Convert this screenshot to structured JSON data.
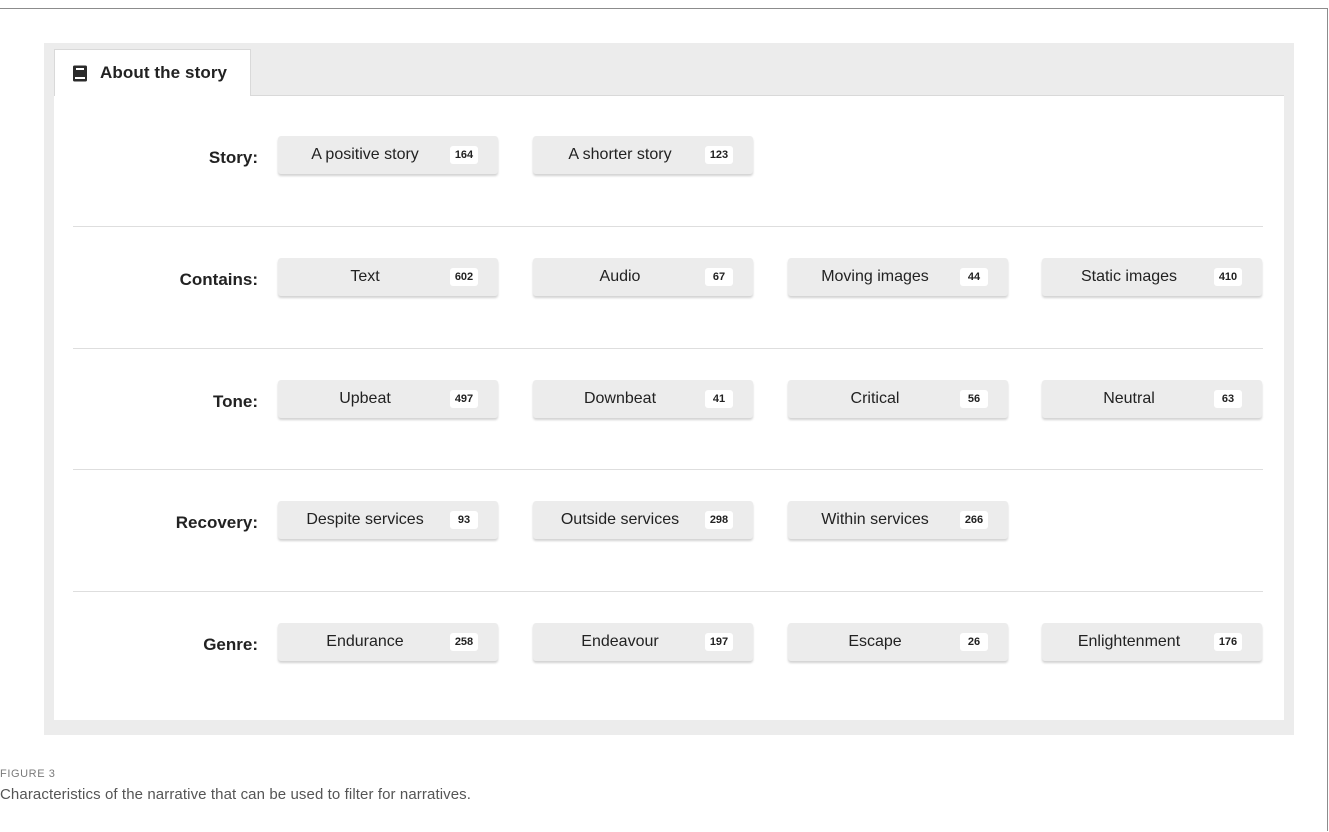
{
  "tab": {
    "icon": "book-icon",
    "label": "About the story"
  },
  "rows": [
    {
      "label": "Story:",
      "options": [
        {
          "text": "A positive story",
          "count": "164"
        },
        {
          "text": "A shorter story",
          "count": "123"
        }
      ]
    },
    {
      "label": "Contains:",
      "options": [
        {
          "text": "Text",
          "count": "602"
        },
        {
          "text": "Audio",
          "count": "67"
        },
        {
          "text": "Moving images",
          "count": "44"
        },
        {
          "text": "Static images",
          "count": "410"
        }
      ]
    },
    {
      "label": "Tone:",
      "options": [
        {
          "text": "Upbeat",
          "count": "497"
        },
        {
          "text": "Downbeat",
          "count": "41"
        },
        {
          "text": "Critical",
          "count": "56"
        },
        {
          "text": "Neutral",
          "count": "63"
        }
      ]
    },
    {
      "label": "Recovery:",
      "options": [
        {
          "text": "Despite services",
          "count": "93"
        },
        {
          "text": "Outside services",
          "count": "298"
        },
        {
          "text": "Within services",
          "count": "266"
        }
      ]
    },
    {
      "label": "Genre:",
      "options": [
        {
          "text": "Endurance",
          "count": "258"
        },
        {
          "text": "Endeavour",
          "count": "197"
        },
        {
          "text": "Escape",
          "count": "26"
        },
        {
          "text": "Enlightenment",
          "count": "176"
        }
      ]
    }
  ],
  "caption": {
    "label": "FIGURE 3",
    "text": "Characteristics of the narrative that can be used to filter for narratives."
  },
  "colors": {
    "panel_bg": "#ececec",
    "chip_bg": "#ececec",
    "badge_bg": "#ffffff",
    "text": "#222222"
  }
}
